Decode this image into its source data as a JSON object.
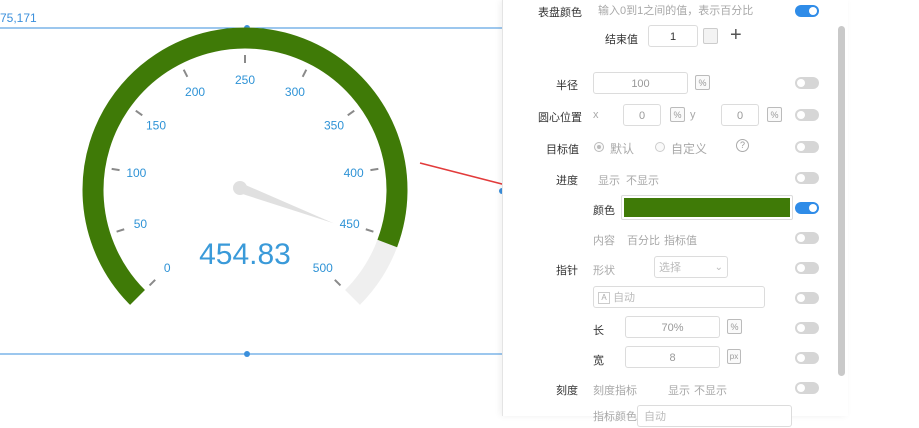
{
  "canvas": {
    "coord_label": "75,171"
  },
  "gauge": {
    "value_text": "454.83",
    "ticks": [
      "0",
      "50",
      "100",
      "150",
      "200",
      "250",
      "300",
      "350",
      "400",
      "450",
      "500"
    ],
    "progress_color": "#3f7a07",
    "track_color": "#efefef",
    "tick_label_color": "#2f93d6",
    "value_color": "#3a9ad9"
  },
  "panel": {
    "dial_color": {
      "label": "表盘颜色",
      "hint": "输入0到1之间的值，表示百分比",
      "enabled": true
    },
    "end_value": {
      "label": "结束值",
      "value": "1",
      "add_symbol": "+"
    },
    "radius": {
      "label": "半径",
      "value": "100",
      "unit": "%",
      "enabled": false
    },
    "center": {
      "label": "圆心位置",
      "x_label": "x",
      "x_value": "0",
      "x_unit": "%",
      "y_label": "y",
      "y_value": "0",
      "y_unit": "%",
      "enabled": false
    },
    "target": {
      "label": "目标值",
      "option_default": "默认",
      "option_custom": "自定义",
      "help_symbol": "?",
      "enabled": false
    },
    "progress": {
      "label": "进度",
      "show": "显示",
      "hide": "不显示",
      "enabled": false
    },
    "color": {
      "label": "颜色",
      "swatch": "#3f7a07",
      "enabled": true
    },
    "content": {
      "label": "内容",
      "percent": "百分比",
      "target_value": "指标值",
      "enabled": false
    },
    "pointer": {
      "label": "指针",
      "shape_label": "形状",
      "shape_placeholder": "选择",
      "font_icon": "A",
      "font_value": "自动",
      "length_label": "长",
      "length_value": "70%",
      "length_unit": "%",
      "width_label": "宽",
      "width_value": "8",
      "width_unit": "px",
      "enabled_shape": false,
      "enabled_font": false,
      "enabled_length": false,
      "enabled_width": false
    },
    "scale": {
      "label": "刻度",
      "metric_label": "刻度指标",
      "show": "显示",
      "hide": "不显示",
      "enabled": false
    },
    "bottom_partial": {
      "label": "指标颜色",
      "value": "自动"
    }
  },
  "colors": {
    "arrow": "#e23b3b",
    "selection": "#3a8fdc",
    "toggle_on": "#2f8ce8"
  }
}
